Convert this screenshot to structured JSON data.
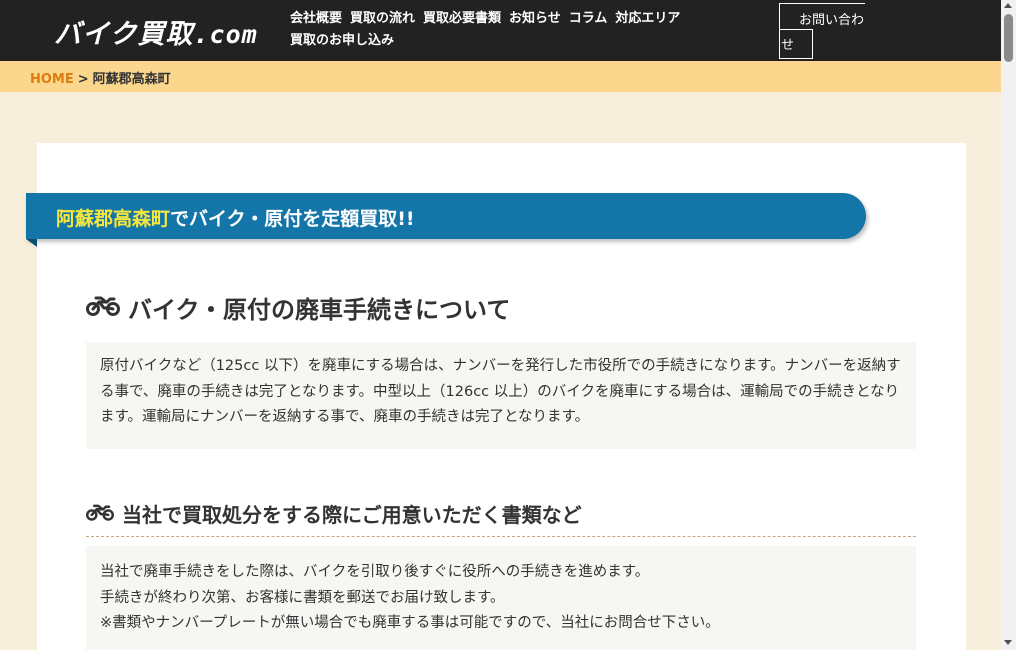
{
  "header": {
    "logo_main": "バイク買取",
    "logo_suffix": ".com",
    "nav": [
      "会社概要",
      "買取の流れ",
      "買取必要書類",
      "お知らせ",
      "コラム",
      "対応エリア",
      "買取のお申し込み"
    ],
    "contact_line1": "お問い合わ",
    "contact_line2": "せ"
  },
  "breadcrumb": {
    "home": "HOME",
    "separator": ">",
    "current": "阿蘇郡高森町"
  },
  "banner": {
    "highlight": "阿蘇郡高森町",
    "rest": "でバイク・原付を定額買取!!"
  },
  "section1": {
    "icon": "motorcycle-icon",
    "heading": "バイク・原付の廃車手続きについて",
    "body": "原付バイクなど（125cc 以下）を廃車にする場合は、ナンバーを発行した市役所での手続きになります。ナンバーを返納する事で、廃車の手続きは完了となります。中型以上（126cc 以上）のバイクを廃車にする場合は、運輸局での手続きとなります。運輸局にナンバーを返納する事で、廃車の手続きは完了となります。"
  },
  "section2": {
    "icon": "motorcycle-icon",
    "heading": "当社で買取処分をする際にご用意いただく書類など",
    "lines": [
      "当社で廃車手続きをした際は、バイクを引取り後すぐに役所への手続きを進めます。",
      "手続きが終わり次第、お客様に書類を郵送でお届け致します。",
      "※書類やナンバープレートが無い場合でも廃車する事は可能ですので、当社にお問合せ下さい。"
    ]
  },
  "colors": {
    "header_bg": "#222222",
    "breadcrumb_bg": "#fbd78e",
    "page_bg": "#f7eedb",
    "banner_bg": "#1476a8",
    "banner_highlight": "#f6e63d",
    "home_link": "#e07b10"
  }
}
